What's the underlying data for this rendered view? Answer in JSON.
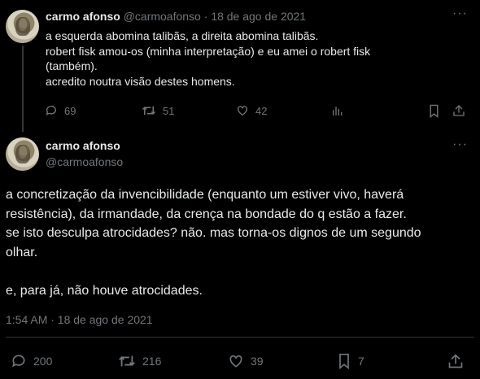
{
  "tweet1": {
    "display_name": "carmo afonso",
    "handle": "@carmoafonso",
    "separator": "·",
    "date": "18 de ago de 2021",
    "more_label": "···",
    "text": "a esquerda abomina talibãs, a direita abomina talibãs.\nrobert fisk amou-os (minha interpretação) e eu amei o robert fisk\n(também).\nacredito noutra visão destes homens.",
    "actions": {
      "reply_count": "69",
      "retweet_count": "51",
      "like_count": "42"
    }
  },
  "tweet2": {
    "display_name": "carmo afonso",
    "handle": "@carmoafonso",
    "more_label": "···",
    "text": "a concretização da invencibilidade (enquanto um estiver vivo, haverá\nresistência), da irmandade, da crença na bondade do q estão a fazer.\nse isto desculpa atrocidades? não. mas torna-os dignos de um segundo\nolhar.\n\ne, para já, não houve atrocidades.",
    "timestamp": "1:54 AM · 18 de ago de 2021",
    "actions": {
      "reply_count": "200",
      "retweet_count": "216",
      "like_count": "39",
      "bookmark_count": "7"
    }
  },
  "colors": {
    "background": "#000000",
    "text": "#e7e9ea",
    "muted": "#71767b",
    "line": "#333639"
  },
  "icons": [
    "reply-icon",
    "retweet-icon",
    "like-icon",
    "views-icon",
    "bookmark-icon",
    "share-icon",
    "more-icon"
  ]
}
